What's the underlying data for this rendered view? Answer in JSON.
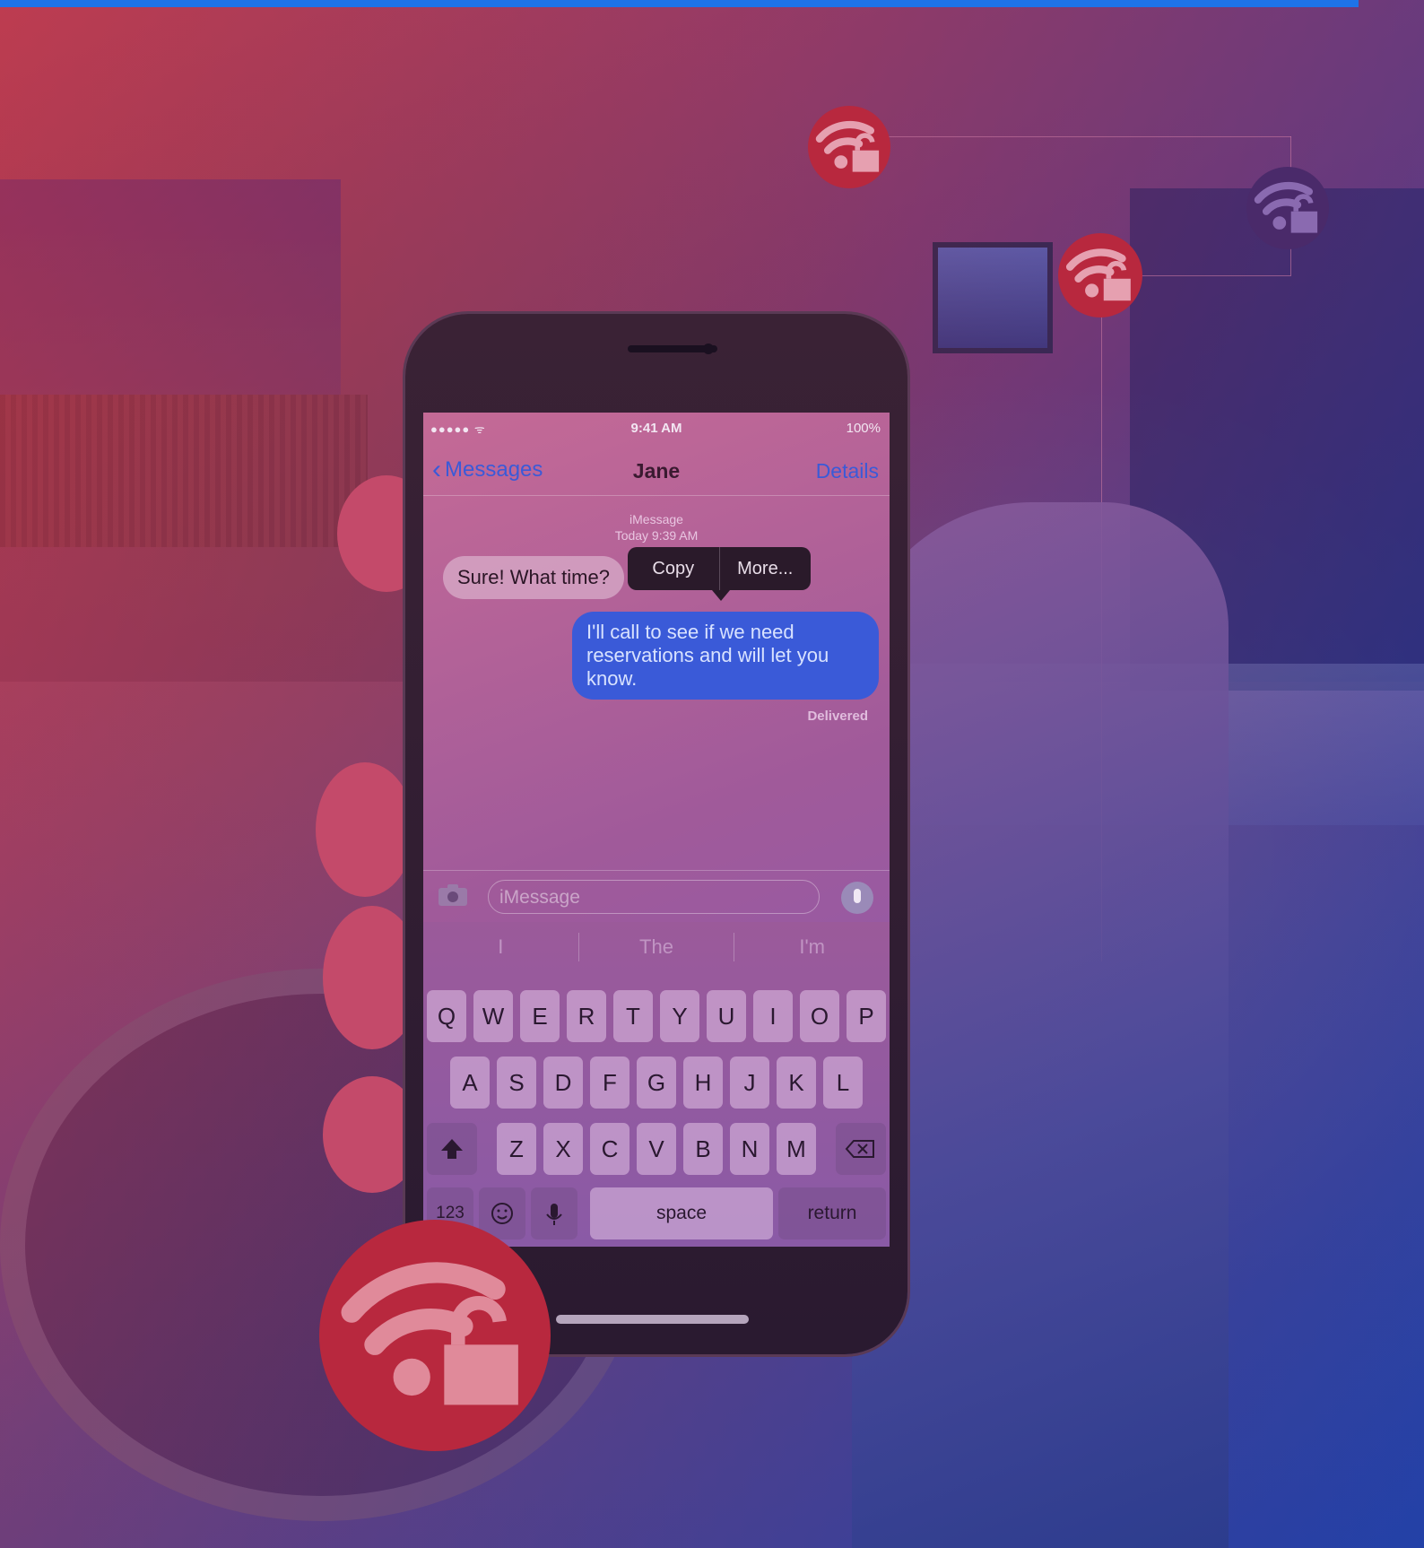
{
  "status_bar": {
    "signal": "●●●●● ᯤ",
    "time": "9:41 AM",
    "battery": "100%"
  },
  "nav": {
    "back_label": "Messages",
    "title": "Jane",
    "details_label": "Details"
  },
  "thread": {
    "service": "iMessage",
    "timestamp": "Today 9:39 AM"
  },
  "messages": {
    "incoming": "Sure! What time?",
    "outgoing": "I'll call to see if we need reservations and will let you know.",
    "status": "Delivered"
  },
  "context_menu": {
    "copy": "Copy",
    "more": "More..."
  },
  "composer": {
    "placeholder": "iMessage"
  },
  "suggestions": [
    "I",
    "The",
    "I'm"
  ],
  "keyboard": {
    "row1": [
      "Q",
      "W",
      "E",
      "R",
      "T",
      "Y",
      "U",
      "I",
      "O",
      "P"
    ],
    "row2": [
      "A",
      "S",
      "D",
      "F",
      "G",
      "H",
      "J",
      "K",
      "L"
    ],
    "row3": [
      "Z",
      "X",
      "C",
      "V",
      "B",
      "N",
      "M"
    ],
    "numbers": "123",
    "space": "space",
    "return": "return"
  },
  "icons": {
    "badge": "wifi-unlock-icon"
  },
  "colors": {
    "accent": "#1e73e8",
    "badge": "#b8283e",
    "bubble_out": "#3a5ad8"
  }
}
